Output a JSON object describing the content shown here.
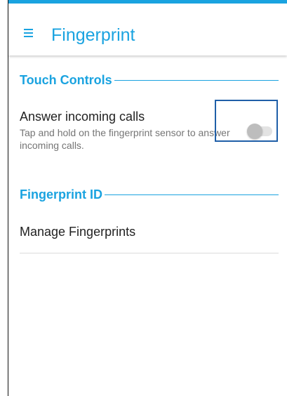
{
  "app_bar": {
    "title": "Fingerprint",
    "menu_icon": "hamburger-menu-icon"
  },
  "sections": {
    "touch_controls": {
      "header": "Touch Controls",
      "answer_calls": {
        "title": "Answer incoming calls",
        "summary": "Tap and hold on the fingerprint sensor to answer incoming calls.",
        "toggle_on": false
      }
    },
    "fingerprint_id": {
      "header": "Fingerprint ID",
      "manage": {
        "title": "Manage Fingerprints"
      }
    }
  },
  "colors": {
    "accent": "#1aa3e0",
    "focus_outline": "#1f5fa8",
    "toggle_off_thumb": "#bdbdbd",
    "toggle_off_track": "#e3e3e3"
  }
}
